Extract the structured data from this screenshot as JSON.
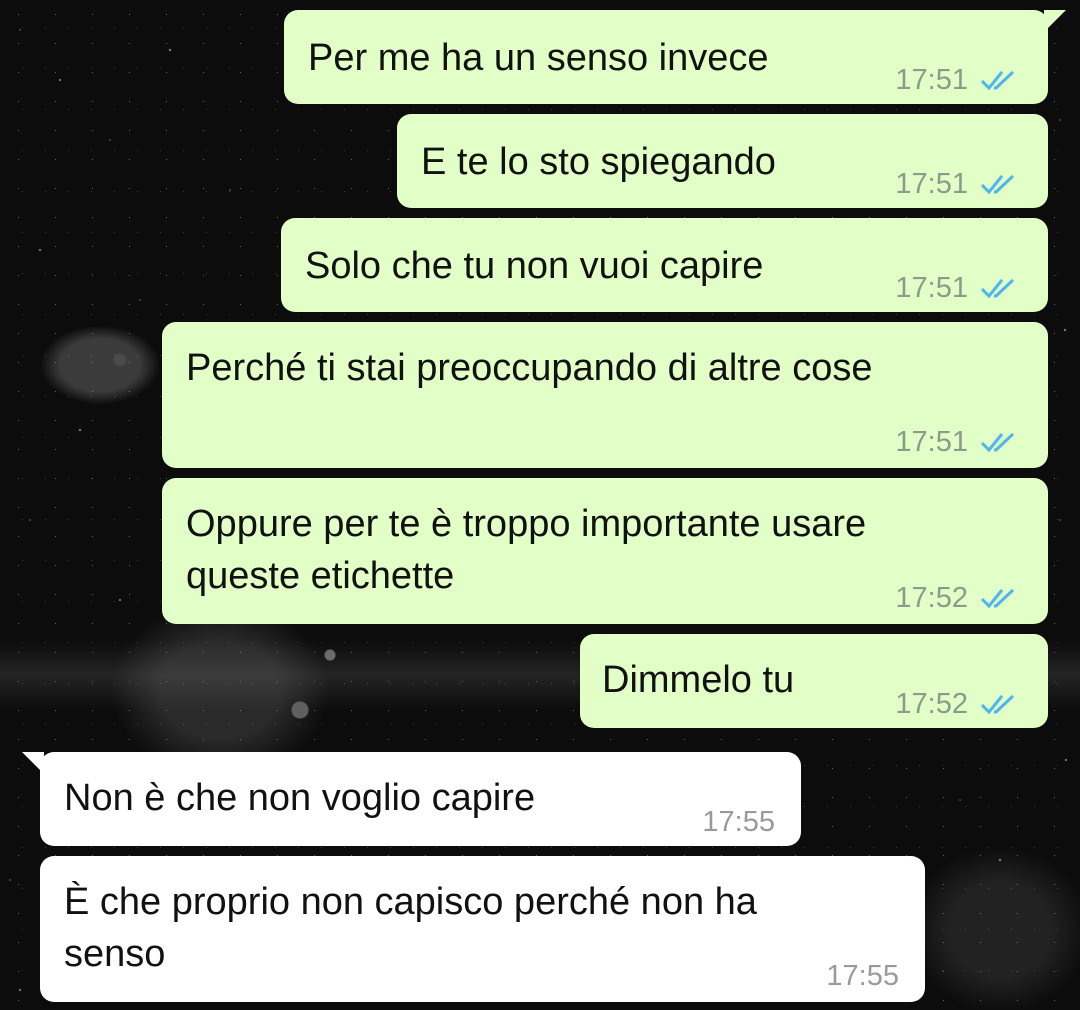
{
  "theme": {
    "outgoing_bubble": "#e1ffc7",
    "incoming_bubble": "#ffffff",
    "read_ticks": "#4fb6ec",
    "background": "#0c0c0c"
  },
  "messages": [
    {
      "direction": "outgoing",
      "text": "Per me ha un senso invece",
      "time": "17:51",
      "status": "read",
      "status_icon": "double-check-icon"
    },
    {
      "direction": "outgoing",
      "text": "E te lo sto spiegando",
      "time": "17:51",
      "status": "read",
      "status_icon": "double-check-icon"
    },
    {
      "direction": "outgoing",
      "text": "Solo che tu non vuoi capire",
      "time": "17:51",
      "status": "read",
      "status_icon": "double-check-icon"
    },
    {
      "direction": "outgoing",
      "text": "Perché ti stai preoccupando di altre cose",
      "time": "17:51",
      "status": "read",
      "status_icon": "double-check-icon"
    },
    {
      "direction": "outgoing",
      "text": "Oppure per te è troppo importante usare\nqueste etichette",
      "time": "17:52",
      "status": "read",
      "status_icon": "double-check-icon"
    },
    {
      "direction": "outgoing",
      "text": "Dimmelo tu",
      "time": "17:52",
      "status": "read",
      "status_icon": "double-check-icon"
    },
    {
      "direction": "incoming",
      "text": "Non è che non voglio capire",
      "time": "17:55"
    },
    {
      "direction": "incoming",
      "text": "È che proprio non capisco perché non ha\nsenso",
      "time": "17:55"
    }
  ]
}
